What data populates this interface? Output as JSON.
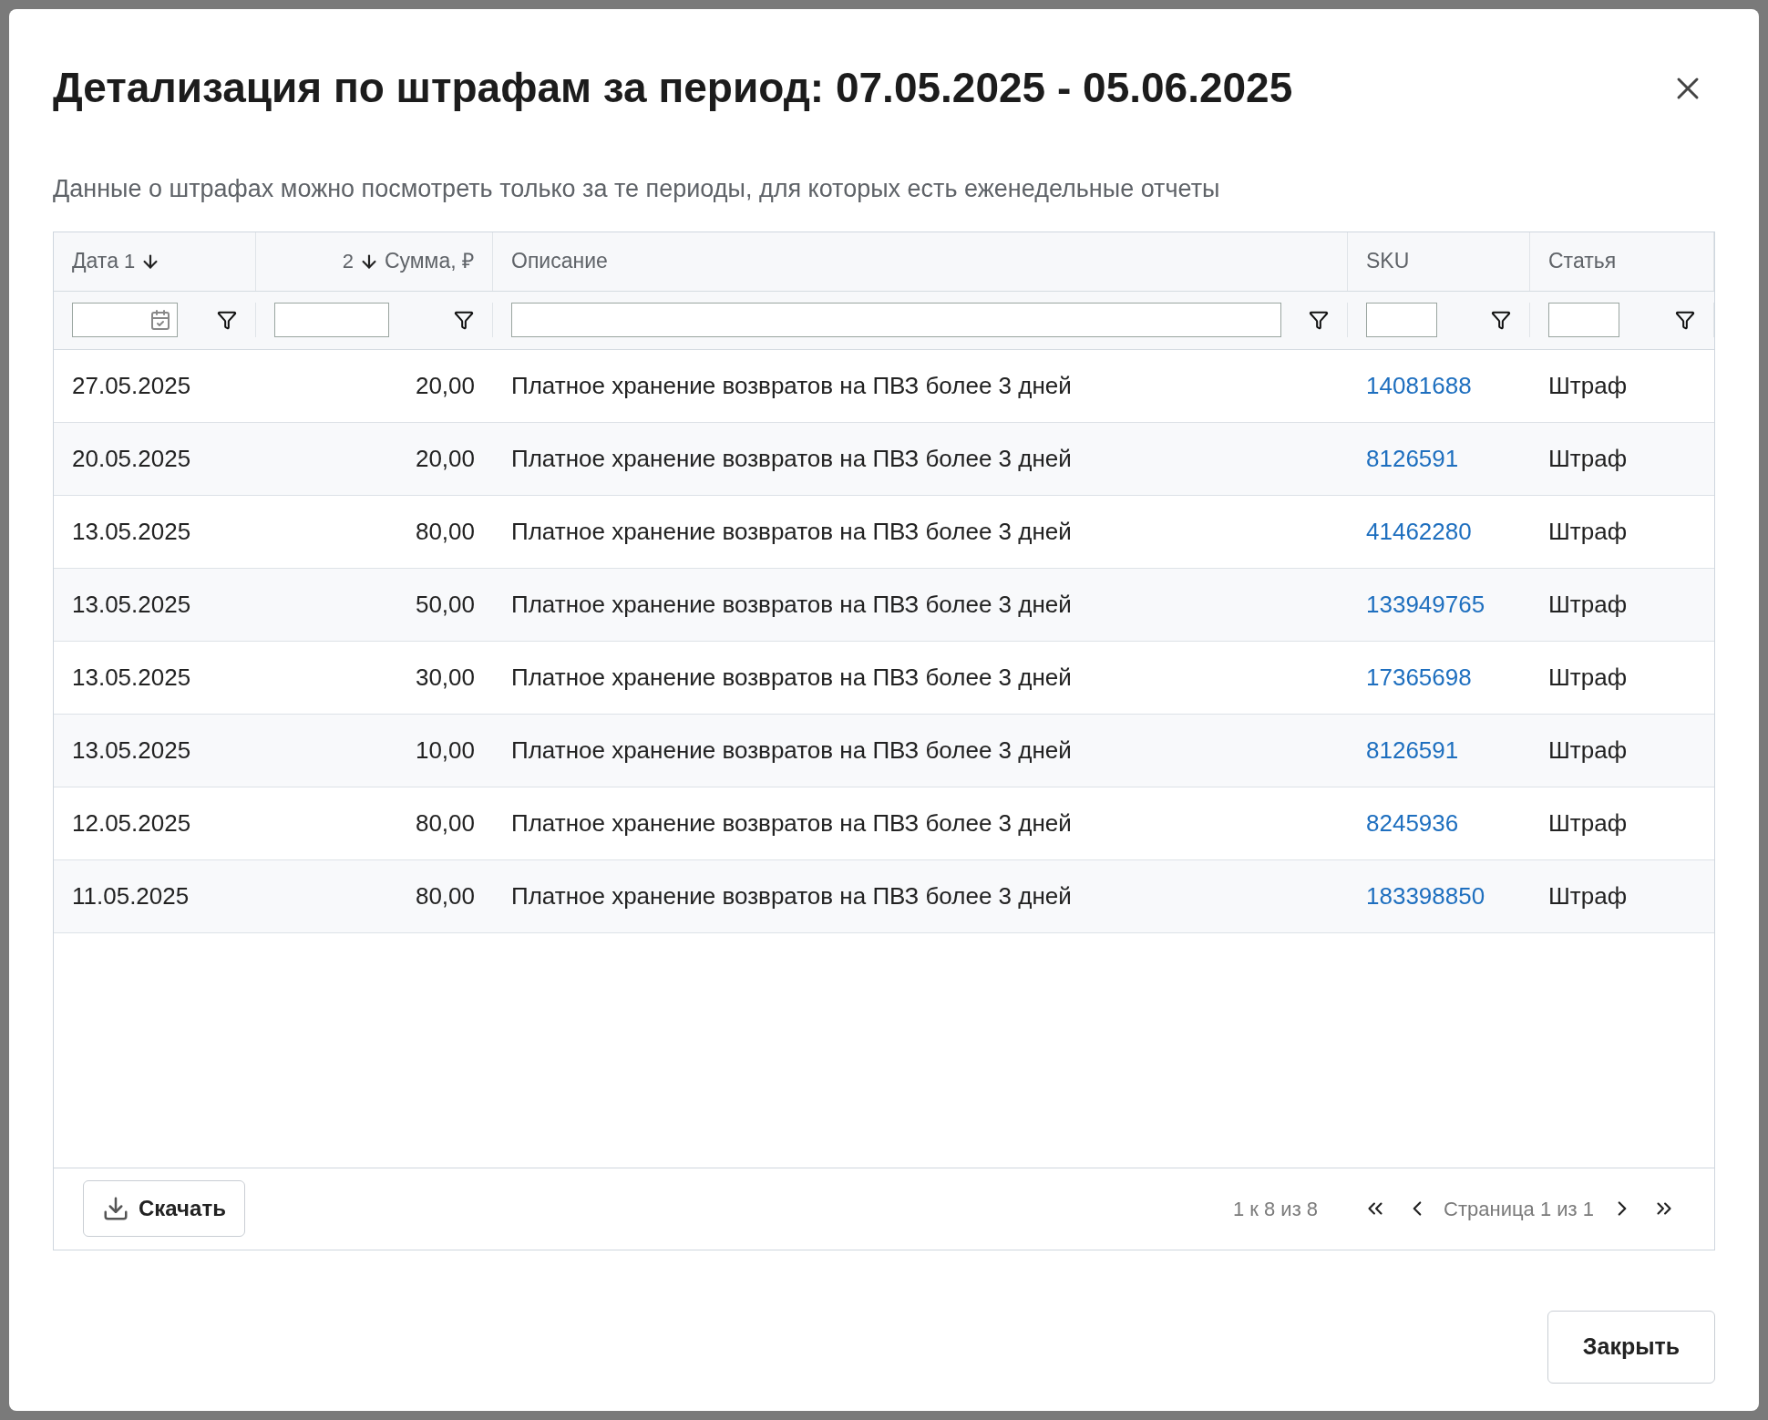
{
  "dialog": {
    "title": "Детализация по штрафам за период: 07.05.2025 - 05.06.2025",
    "note": "Данные о штрафах можно посмотреть только за те периоды, для которых есть еженедельные отчеты"
  },
  "table": {
    "columns": [
      {
        "label": "Дата",
        "kind": "date",
        "sort_order": "1",
        "sort_descending": true
      },
      {
        "label": "Сумма, ₽",
        "kind": "amount",
        "sort_order": "2",
        "sort_descending": true
      },
      {
        "label": "Описание",
        "kind": "text"
      },
      {
        "label": "SKU",
        "kind": "link"
      },
      {
        "label": "Статья",
        "kind": "text"
      }
    ],
    "rows": [
      [
        "27.05.2025",
        "20,00",
        "Платное хранение возвратов на ПВЗ более 3 дней",
        "14081688",
        "Штраф"
      ],
      [
        "20.05.2025",
        "20,00",
        "Платное хранение возвратов на ПВЗ более 3 дней",
        "8126591",
        "Штраф"
      ],
      [
        "13.05.2025",
        "80,00",
        "Платное хранение возвратов на ПВЗ более 3 дней",
        "41462280",
        "Штраф"
      ],
      [
        "13.05.2025",
        "50,00",
        "Платное хранение возвратов на ПВЗ более 3 дней",
        "133949765",
        "Штраф"
      ],
      [
        "13.05.2025",
        "30,00",
        "Платное хранение возвратов на ПВЗ более 3 дней",
        "17365698",
        "Штраф"
      ],
      [
        "13.05.2025",
        "10,00",
        "Платное хранение возвратов на ПВЗ более 3 дней",
        "8126591",
        "Штраф"
      ],
      [
        "12.05.2025",
        "80,00",
        "Платное хранение возвратов на ПВЗ более 3 дней",
        "8245936",
        "Штраф"
      ],
      [
        "11.05.2025",
        "80,00",
        "Платное хранение возвратов на ПВЗ более 3 дней",
        "183398850",
        "Штраф"
      ]
    ]
  },
  "footer": {
    "download_button": "Скачать",
    "range": "1 к 8 из 8",
    "page": "Страница 1 из 1"
  },
  "close_button": "Закрыть"
}
